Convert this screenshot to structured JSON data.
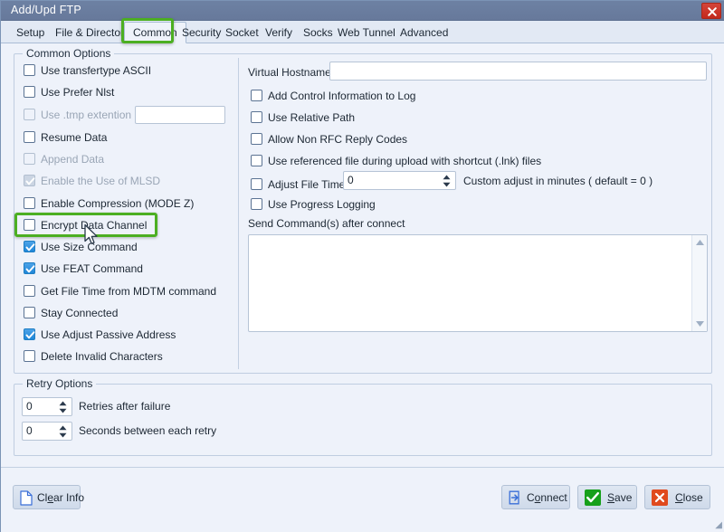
{
  "window": {
    "title": "Add/Upd FTP",
    "close_icon": "close-x-icon"
  },
  "tabs": [
    {
      "label": "Setup",
      "active": false
    },
    {
      "label": "File & Directory",
      "active": false
    },
    {
      "label": "Common",
      "active": true
    },
    {
      "label": "Security",
      "active": false
    },
    {
      "label": "Socket",
      "active": false
    },
    {
      "label": "Verify",
      "active": false
    },
    {
      "label": "Socks",
      "active": false
    },
    {
      "label": "Web Tunnel",
      "active": false
    },
    {
      "label": "Advanced",
      "active": false
    }
  ],
  "common_options": {
    "group_title": "Common Options",
    "left_checkboxes": [
      {
        "label": "Use transfertype ASCII",
        "checked": false,
        "disabled": false
      },
      {
        "label": "Use Prefer Nlst",
        "checked": false,
        "disabled": false
      },
      {
        "label": "Use .tmp extention",
        "checked": false,
        "disabled": true
      },
      {
        "label": "Resume Data",
        "checked": false,
        "disabled": false
      },
      {
        "label": "Append Data",
        "checked": false,
        "disabled": true
      },
      {
        "label": "Enable the Use of MLSD",
        "checked": true,
        "disabled": true
      },
      {
        "label": "Enable Compression (MODE Z)",
        "checked": false,
        "disabled": false
      },
      {
        "label": "Encrypt Data Channel",
        "checked": false,
        "disabled": false
      },
      {
        "label": "Use Size Command",
        "checked": true,
        "disabled": false
      },
      {
        "label": "Use FEAT Command",
        "checked": true,
        "disabled": false
      },
      {
        "label": "Get File Time from MDTM command",
        "checked": false,
        "disabled": false
      },
      {
        "label": "Stay Connected",
        "checked": false,
        "disabled": false
      },
      {
        "label": "Use Adjust Passive Address",
        "checked": true,
        "disabled": false
      },
      {
        "label": "Delete Invalid Characters",
        "checked": false,
        "disabled": false
      }
    ],
    "tmp_extension_value": "",
    "tmp_extension_placeholder": "",
    "virtual_hostname_label": "Virtual Hostname",
    "virtual_hostname_value": "",
    "virtual_hostname_placeholder": "",
    "right_checkboxes": [
      {
        "label": "Add Control Information to Log",
        "checked": false
      },
      {
        "label": "Use Relative Path",
        "checked": false
      },
      {
        "label": "Allow Non RFC Reply Codes",
        "checked": false
      },
      {
        "label": "Use referenced file during upload with shortcut (.lnk) files",
        "checked": false
      },
      {
        "label": "Adjust File Times",
        "checked": false
      },
      {
        "label": "Use Progress Logging",
        "checked": false
      }
    ],
    "adjust_file_times_value": "0",
    "adjust_file_times_hint": "Custom adjust in minutes ( default = 0 )",
    "send_commands_label": "Send Command(s) after connect",
    "send_commands_value": "",
    "send_commands_placeholder": ""
  },
  "retry_options": {
    "group_title": "Retry Options",
    "retries_value": "0",
    "retries_label": "Retries after failure",
    "seconds_value": "0",
    "seconds_label": "Seconds between each retry"
  },
  "footer": {
    "clear_info": {
      "pre": "Cl",
      "accel": "e",
      "post": "ar Info",
      "icon": "document-icon"
    },
    "connect": {
      "pre": "C",
      "accel": "o",
      "post": "nnect",
      "icon": "login-arrow-icon"
    },
    "save": {
      "pre": "",
      "accel": "S",
      "post": "ave",
      "icon": "green-check-icon"
    },
    "close": {
      "pre": "",
      "accel": "C",
      "post": "lose",
      "icon": "red-x-icon"
    }
  },
  "annotations": {
    "tab_highlight": "Common",
    "option_highlight": "Encrypt Data Channel",
    "highlight_color": "#4caf22"
  }
}
